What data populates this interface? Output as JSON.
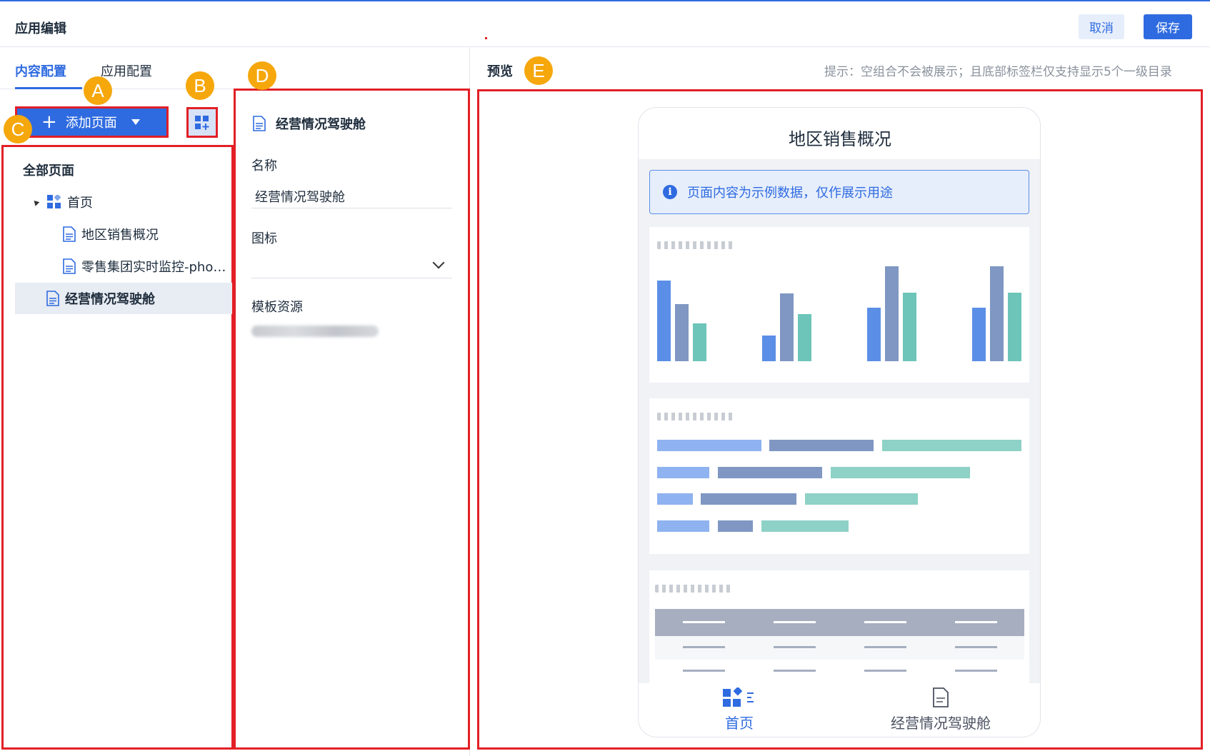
{
  "header": {
    "title": "应用编辑",
    "cancel_label": "取消",
    "save_label": "保存"
  },
  "tabs": {
    "content": "内容配置",
    "app": "应用配置"
  },
  "markers": {
    "a": "A",
    "b": "B",
    "c": "C",
    "d": "D",
    "e": "E"
  },
  "left": {
    "add_page_label": "添加页面",
    "all_pages": "全部页面",
    "tree": [
      {
        "label": "首页",
        "icon": "home-grid-icon"
      },
      {
        "label": "地区销售概况",
        "icon": "document-icon"
      },
      {
        "label": "零售集团实时监控-pho…",
        "icon": "document-icon"
      },
      {
        "label": "经营情况驾驶舱",
        "icon": "document-icon",
        "selected": true
      }
    ]
  },
  "detail": {
    "title": "经营情况驾驶舱",
    "name_label": "名称",
    "name_value": "经营情况驾驶舱",
    "icon_label": "图标",
    "template_label": "模板资源"
  },
  "preview": {
    "title": "预览",
    "tip": "提示：空组合不会被展示；且底部标签栏仅支持显示5个一级目录",
    "phone": {
      "page_title": "地区销售概况",
      "info": "页面内容为示例数据，仅作展示用途",
      "nav": [
        {
          "label": "首页",
          "icon": "home-grid-icon",
          "active": true
        },
        {
          "label": "经营情况驾驶舱",
          "icon": "document-icon",
          "active": false
        }
      ]
    }
  },
  "colors": {
    "accent": "#2f6be0",
    "highlight_border": "#e21f26",
    "marker": "#f5a70c"
  }
}
